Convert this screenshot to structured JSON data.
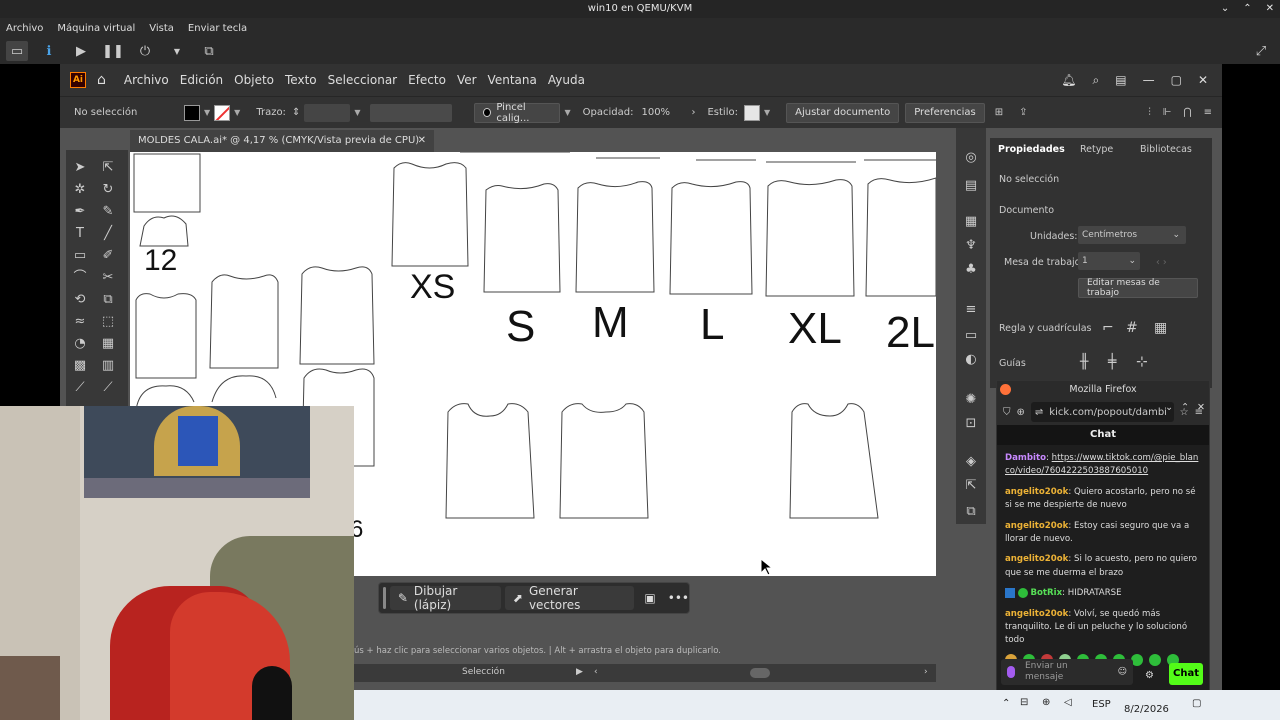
{
  "vm": {
    "title": "win10 en QEMU/KVM",
    "menu": [
      "Archivo",
      "Máquina virtual",
      "Vista",
      "Enviar tecla"
    ],
    "window_buttons": [
      "⌄",
      "⌃",
      "✕"
    ]
  },
  "ai": {
    "logo": "Ai",
    "menu": [
      "Archivo",
      "Edición",
      "Objeto",
      "Texto",
      "Seleccionar",
      "Efecto",
      "Ver",
      "Ventana",
      "Ayuda"
    ],
    "control": {
      "selection": "No selección",
      "stroke_label": "Trazo:",
      "brush": "Pincel calig...",
      "opacity_label": "Opacidad:",
      "opacity": "100%",
      "style_label": "Estilo:",
      "fit_button": "Ajustar documento",
      "prefs_button": "Preferencias"
    },
    "doc_tab": "MOLDES CALA.ai* @ 4,17 % (CMYK/Vista previa de CPU)",
    "canvas": {
      "size_labels": [
        "12",
        "XS",
        "S",
        "M",
        "L",
        "XL",
        "2L",
        "6"
      ]
    },
    "ctx": {
      "draw": "Dibujar (lápiz)",
      "vectors": "Generar vectores"
    },
    "hint": "ús + haz clic para seleccionar varios objetos.  |  Alt + arrastra el objeto para duplicarlo.",
    "status_tool": "Selección",
    "props": {
      "tabs": [
        "Propiedades",
        "Retype",
        "Bibliotecas"
      ],
      "no_sel": "No selección",
      "doc": "Documento",
      "units_label": "Unidades:",
      "units": "Centímetros",
      "artboard_label": "Mesa de trabajo:",
      "artboard": "1",
      "edit_btn": "Editar mesas de trabajo",
      "rulers": "Regla y cuadrículas",
      "guides": "Guías"
    }
  },
  "firefox": {
    "title": "Mozilla Firefox",
    "url": "kick.com/popout/dambi",
    "chat_title": "Chat",
    "messages": [
      {
        "user": "Dambito",
        "text": "https://www.tiktok.com/@pie_blanco/video/7604222503887605010",
        "kind": "pur"
      },
      {
        "user": "angelito20ok",
        "text": "Quiero acostarlo, pero no sé si se me despierte de nuevo",
        "kind": "norm"
      },
      {
        "user": "angelito20ok",
        "text": "Estoy casi seguro que va a llorar de nuevo.",
        "kind": "norm"
      },
      {
        "user": "angelito20ok",
        "text": "Si lo acuesto, pero no quiero que se me duerma el brazo",
        "kind": "norm"
      },
      {
        "user": "BotRix",
        "text": "HIDRATARSE",
        "kind": "bot"
      },
      {
        "user": "angelito20ok",
        "text": "Volví, se quedó más tranquilito. Le di un peluche y lo solucionó todo",
        "kind": "norm"
      }
    ],
    "input_placeholder": "Enviar un mensaje",
    "send": "Chat"
  },
  "taskbar": {
    "lang": "ESP",
    "date": "8/2/2026"
  }
}
